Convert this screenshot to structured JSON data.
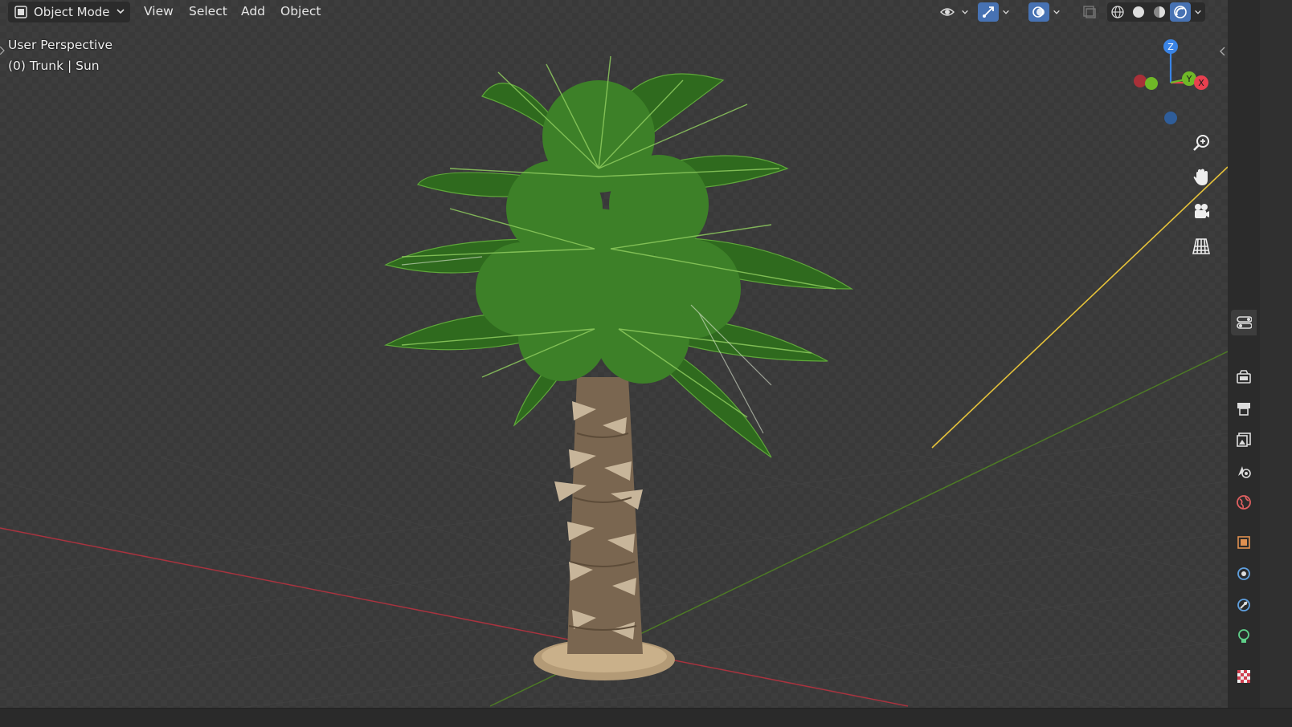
{
  "header": {
    "mode_label": "Object Mode",
    "menus": [
      "View",
      "Select",
      "Add",
      "Object"
    ]
  },
  "overlay": {
    "view_name": "User Perspective",
    "active_object": "(0) Trunk | Sun"
  },
  "gizmo": {
    "z_label": "Z",
    "y_label": "Y",
    "x_label": "X"
  },
  "colors": {
    "accent": "#4772b3",
    "x_axis": "#e8404f",
    "y_axis": "#6fb827",
    "z_axis": "#3a84e6",
    "light_line": "#e5c23a"
  },
  "icons": {
    "mode": "object-mode-icon",
    "visibility": "eye-icon",
    "gizmo": "gizmo-arrow-icon",
    "overlays": "overlay-icon",
    "xray": "xray-icon",
    "shading": [
      "wireframe-icon",
      "solid-icon",
      "material-icon",
      "rendered-icon"
    ],
    "nav": [
      "zoom-icon",
      "hand-pan-icon",
      "camera-icon",
      "ortho-grid-icon"
    ],
    "properties": [
      "tool-icon",
      "render-icon",
      "output-icon",
      "view-layer-icon",
      "scene-icon",
      "world-icon",
      "object-icon",
      "modifier-icon",
      "physics-icon",
      "object-data-light-icon",
      "texture-icon"
    ]
  }
}
